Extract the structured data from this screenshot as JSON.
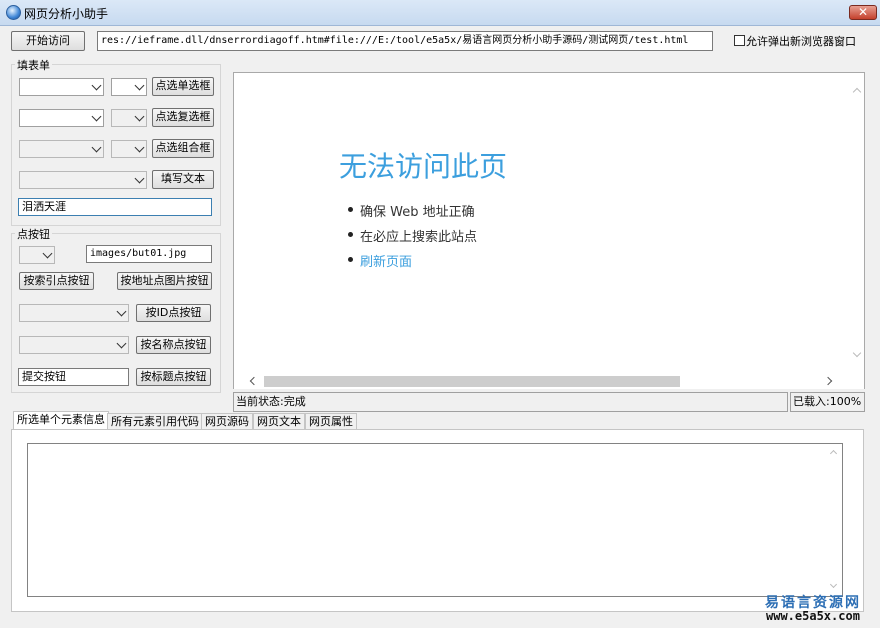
{
  "window": {
    "title": "网页分析小助手",
    "close_label": "✕"
  },
  "toolbar": {
    "start_button": "开始访问",
    "url_value": "res://ieframe.dll/dnserrordiagoff.htm#file:///E:/tool/e5a5x/易语言网页分析小助手源码/测试网页/test.html",
    "allow_popup_label": "允许弹出新浏览器窗口",
    "allow_popup_checked": false
  },
  "fill_form": {
    "group_label": "填表单",
    "radio_button": "点选单选框",
    "checkbox_button": "点选复选框",
    "combo_button": "点选组合框",
    "fill_text_button": "填写文本",
    "text_input_value": "泪洒天涯"
  },
  "click_button": {
    "group_label": "点按钮",
    "image_path_value": "images/but01.jpg",
    "by_index_button": "按索引点按钮",
    "by_image_button": "按地址点图片按钮",
    "by_id_button": "按ID点按钮",
    "by_name_button": "按名称点按钮",
    "title_input_value": "提交按钮",
    "by_title_button": "按标题点按钮"
  },
  "browser": {
    "error_title": "无法访问此页",
    "error_items": [
      "确保 Web 地址正确",
      "在必应上搜索此站点"
    ],
    "refresh_link": "刷新页面",
    "link_color": "#3c9fde"
  },
  "status_bar": {
    "state": "当前状态:完成",
    "loaded": "已载入:100%"
  },
  "tabs": [
    {
      "label": "所选单个元素信息",
      "active": true
    },
    {
      "label": "所有元素引用代码",
      "active": false
    },
    {
      "label": "网页源码",
      "active": false
    },
    {
      "label": "网页文本",
      "active": false
    },
    {
      "label": "网页属性",
      "active": false
    }
  ],
  "watermark": {
    "line1": "易语言资源网",
    "line2": "www.e5a5x.com"
  }
}
